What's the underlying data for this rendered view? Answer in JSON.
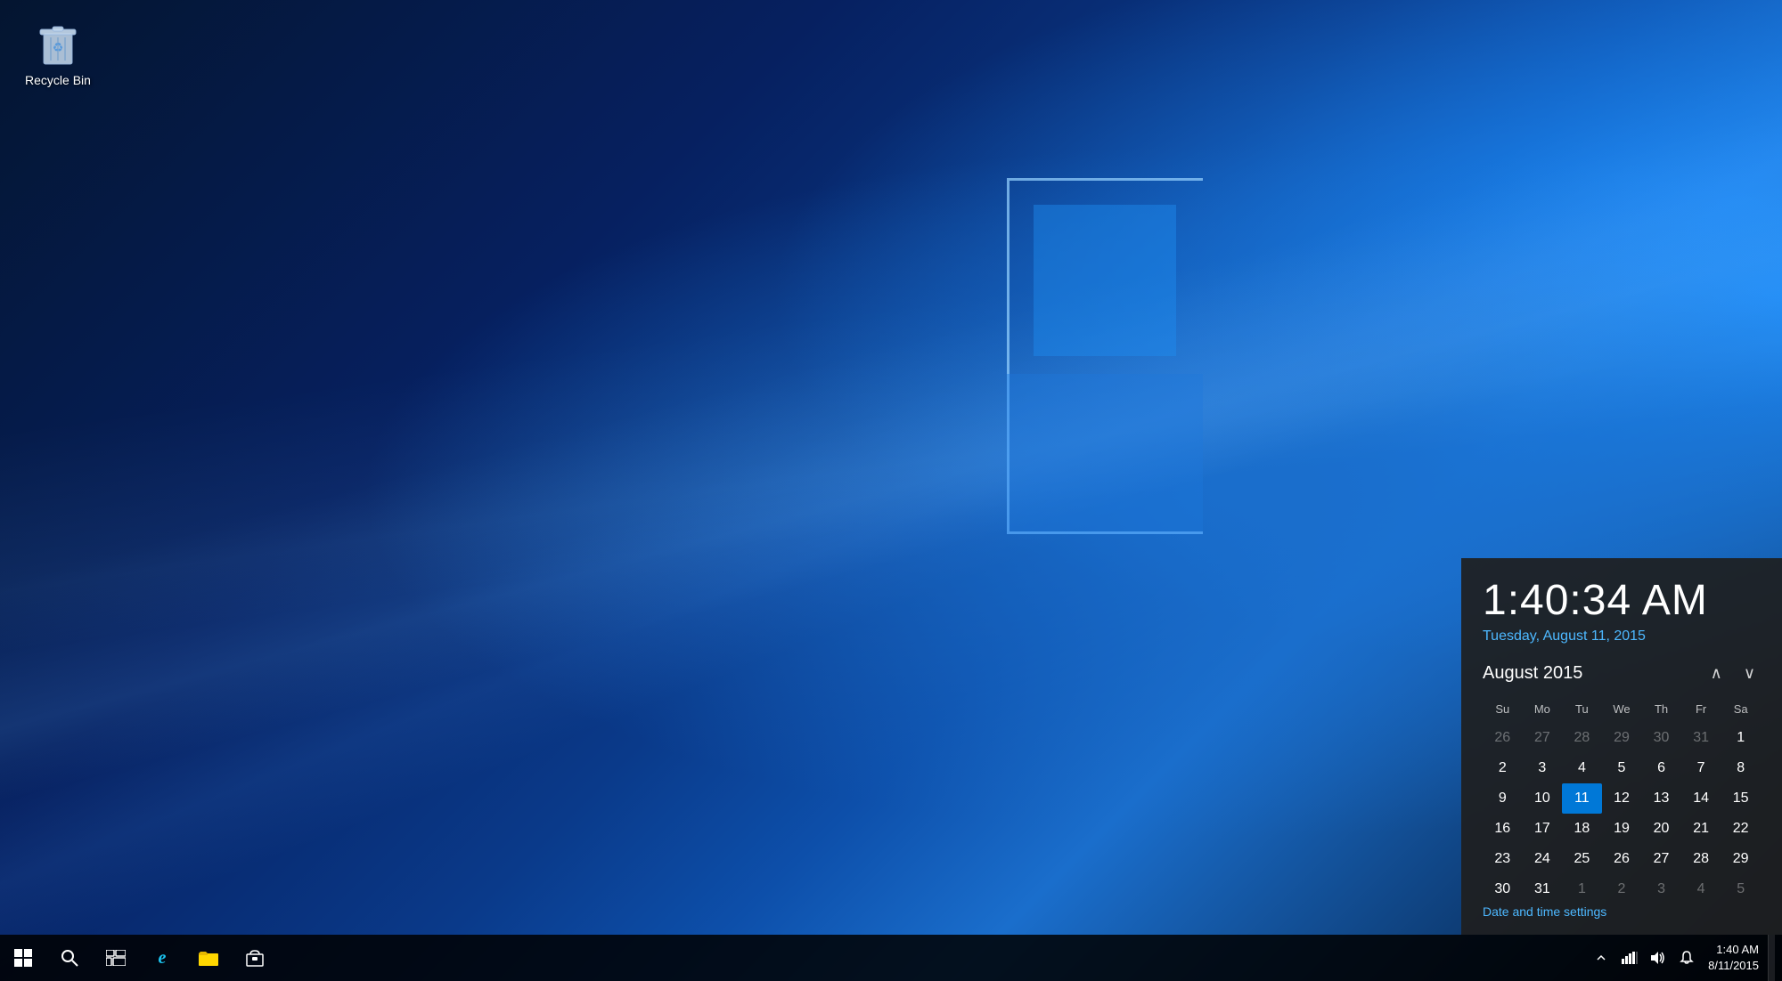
{
  "desktop": {
    "background": "Windows 10 blue wallpaper"
  },
  "recycle_bin": {
    "label": "Recycle Bin"
  },
  "calendar_popup": {
    "time": "1:40:34 AM",
    "date_long": "Tuesday, August 11, 2015",
    "month_year": "August 2015",
    "nav_prev_label": "∧",
    "nav_next_label": "∨",
    "day_headers": [
      "Su",
      "Mo",
      "Tu",
      "We",
      "Th",
      "Fr",
      "Sa"
    ],
    "weeks": [
      [
        {
          "day": "26",
          "type": "other-month"
        },
        {
          "day": "27",
          "type": "other-month"
        },
        {
          "day": "28",
          "type": "other-month"
        },
        {
          "day": "29",
          "type": "other-month"
        },
        {
          "day": "30",
          "type": "other-month"
        },
        {
          "day": "31",
          "type": "other-month"
        },
        {
          "day": "1",
          "type": "normal"
        }
      ],
      [
        {
          "day": "2",
          "type": "normal"
        },
        {
          "day": "3",
          "type": "normal"
        },
        {
          "day": "4",
          "type": "normal"
        },
        {
          "day": "5",
          "type": "normal"
        },
        {
          "day": "6",
          "type": "normal"
        },
        {
          "day": "7",
          "type": "normal"
        },
        {
          "day": "8",
          "type": "normal"
        }
      ],
      [
        {
          "day": "9",
          "type": "normal"
        },
        {
          "day": "10",
          "type": "normal"
        },
        {
          "day": "11",
          "type": "today"
        },
        {
          "day": "12",
          "type": "normal"
        },
        {
          "day": "13",
          "type": "normal"
        },
        {
          "day": "14",
          "type": "normal"
        },
        {
          "day": "15",
          "type": "normal"
        }
      ],
      [
        {
          "day": "16",
          "type": "normal"
        },
        {
          "day": "17",
          "type": "normal"
        },
        {
          "day": "18",
          "type": "normal"
        },
        {
          "day": "19",
          "type": "normal"
        },
        {
          "day": "20",
          "type": "normal"
        },
        {
          "day": "21",
          "type": "normal"
        },
        {
          "day": "22",
          "type": "normal"
        }
      ],
      [
        {
          "day": "23",
          "type": "normal"
        },
        {
          "day": "24",
          "type": "normal"
        },
        {
          "day": "25",
          "type": "normal"
        },
        {
          "day": "26",
          "type": "normal"
        },
        {
          "day": "27",
          "type": "normal"
        },
        {
          "day": "28",
          "type": "normal"
        },
        {
          "day": "29",
          "type": "normal"
        }
      ],
      [
        {
          "day": "30",
          "type": "normal"
        },
        {
          "day": "31",
          "type": "normal"
        },
        {
          "day": "1",
          "type": "other-month"
        },
        {
          "day": "2",
          "type": "other-month"
        },
        {
          "day": "3",
          "type": "other-month"
        },
        {
          "day": "4",
          "type": "other-month"
        },
        {
          "day": "5",
          "type": "other-month"
        }
      ]
    ],
    "settings_link": "Date and time settings"
  },
  "taskbar": {
    "start_button_label": "Start",
    "search_button_label": "Search",
    "task_view_label": "Task View",
    "edge_label": "Microsoft Edge",
    "file_explorer_label": "File Explorer",
    "store_label": "Microsoft Store",
    "tray": {
      "chevron_label": "Show hidden icons",
      "network_label": "Network",
      "volume_label": "Volume",
      "notifications_label": "Notifications"
    },
    "clock": {
      "time": "1:40 AM",
      "date": "8/11/2015"
    },
    "show_desktop_label": "Show desktop"
  }
}
